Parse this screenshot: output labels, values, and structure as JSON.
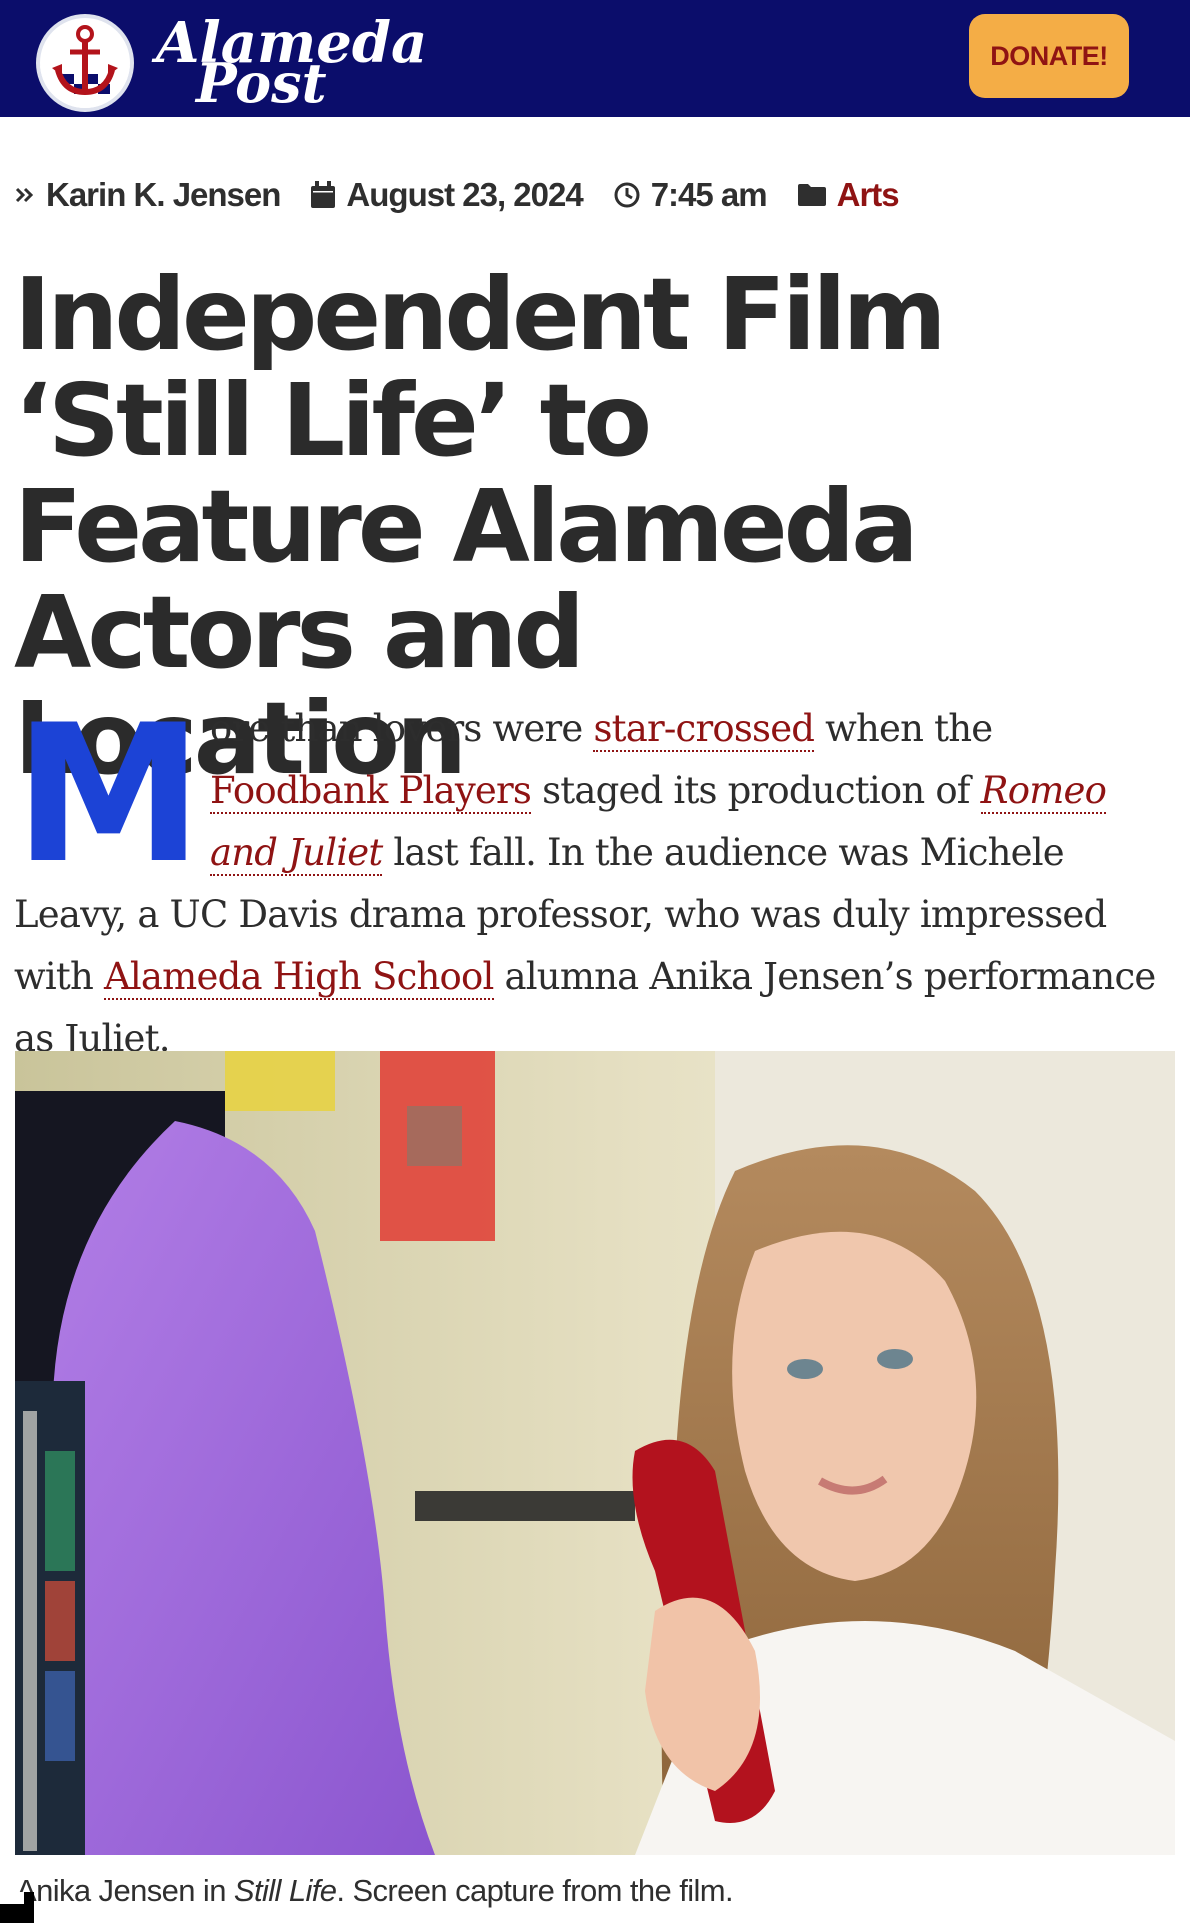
{
  "header": {
    "logo_line1": "Alameda",
    "logo_line2": "Post",
    "donate_label": "DONATE!"
  },
  "meta": {
    "author": "Karin K. Jensen",
    "date": "August 23, 2024",
    "time": "7:45 am",
    "category": "Arts"
  },
  "article": {
    "title": "Independent Film ‘Still Life’ to Feature Alameda Actors and Location",
    "dropcap": "M",
    "lead_parts": {
      "t1": "ore than lovers were ",
      "link1": "star-crossed",
      "t2": " when the ",
      "link2": "Foodbank Players",
      "t3": " staged its production of ",
      "link3": "Romeo and Juliet",
      "t4": " last fall. In the audience was Michele Leavy, a UC Davis drama professor, who was duly impressed with ",
      "link4": "Alameda High School",
      "t5": " alumna Anika Jensen’s performance as Juliet."
    },
    "caption_parts": {
      "c1": "Anika Jensen in ",
      "c2": "Still Life",
      "c3": ". Screen capture from the film."
    }
  },
  "colors": {
    "header_bg": "#0b0d6b",
    "donate_bg": "#f4ad46",
    "donate_text": "#8f1313",
    "link": "#8f1313",
    "dropcap": "#1c43d6"
  },
  "icons": [
    "chevrons-right-icon",
    "calendar-icon",
    "clock-icon",
    "folder-icon",
    "anchor-logo-icon"
  ]
}
